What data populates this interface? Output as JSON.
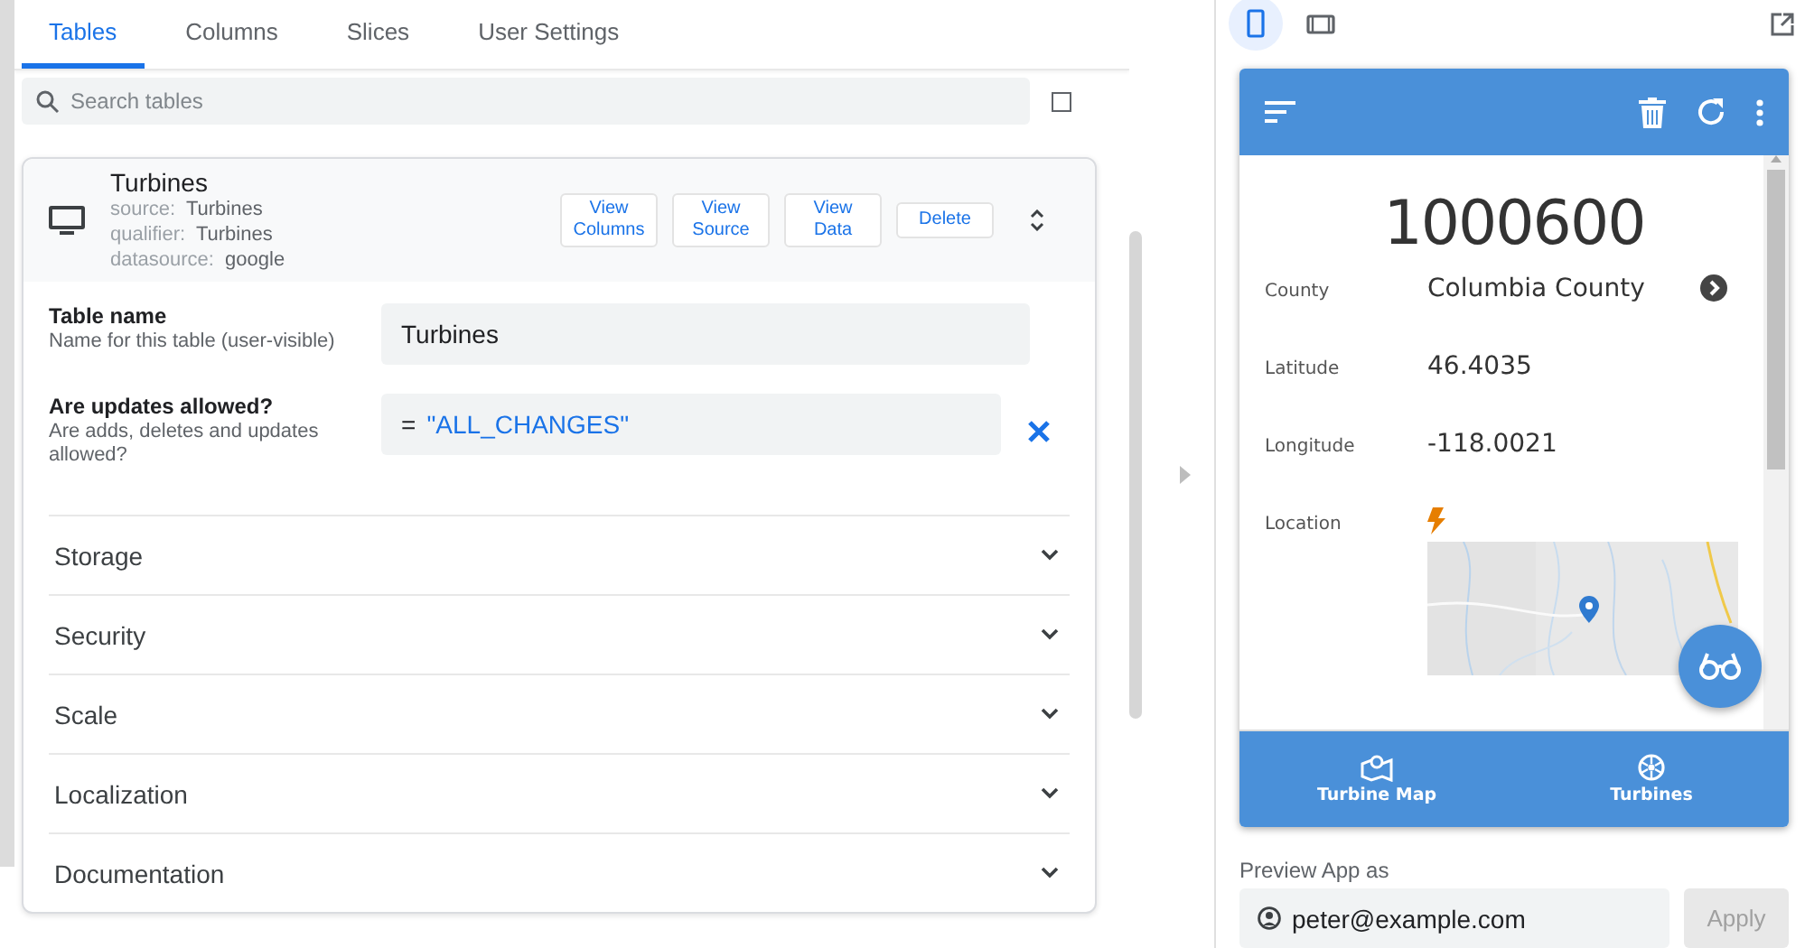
{
  "tabs": [
    {
      "label": "Tables",
      "selected": true
    },
    {
      "label": "Columns",
      "selected": false
    },
    {
      "label": "Slices",
      "selected": false
    },
    {
      "label": "User Settings",
      "selected": false
    }
  ],
  "search": {
    "placeholder": "Search tables"
  },
  "table_card": {
    "title": "Turbines",
    "meta": [
      {
        "label": "source:",
        "value": "Turbines"
      },
      {
        "label": "qualifier:",
        "value": "Turbines"
      },
      {
        "label": "datasource:",
        "value": "google"
      }
    ],
    "buttons": [
      {
        "label": "View Columns",
        "kind": "view"
      },
      {
        "label": "View Source",
        "kind": "view"
      },
      {
        "label": "View Data",
        "kind": "view"
      },
      {
        "label": "Delete",
        "kind": "delete"
      }
    ]
  },
  "fields": [
    {
      "label": "Table name",
      "hint": "Name for this table (user-visible)",
      "value": "Turbines",
      "kind": "text"
    },
    {
      "label": "Are updates allowed?",
      "hint": "Are adds, deletes and updates allowed?",
      "operator": "=",
      "value": "\"ALL_CHANGES\"",
      "kind": "formula"
    }
  ],
  "sections": [
    {
      "label": "Storage",
      "expanded": false
    },
    {
      "label": "Security",
      "expanded": false
    },
    {
      "label": "Scale",
      "expanded": false
    },
    {
      "label": "Localization",
      "expanded": false
    },
    {
      "label": "Documentation",
      "expanded": false
    }
  ],
  "preview": {
    "device_modes": [
      {
        "kind": "phone",
        "selected": true
      },
      {
        "kind": "tablet",
        "selected": false
      }
    ],
    "app": {
      "heading": "1000600",
      "details": [
        {
          "label": "County",
          "value": "Columbia County",
          "kind": "ref"
        },
        {
          "label": "Latitude",
          "value": "46.4035",
          "kind": "text"
        },
        {
          "label": "Longitude",
          "value": "-118.0021",
          "kind": "text"
        },
        {
          "label": "Location",
          "kind": "map"
        }
      ],
      "nav": [
        {
          "label": "Turbine Map",
          "kind": "map"
        },
        {
          "label": "Turbines",
          "kind": "wheel"
        }
      ]
    },
    "preview_as": {
      "label": "Preview App as",
      "value": "peter@example.com",
      "button": "Apply",
      "button_disabled": true
    }
  }
}
